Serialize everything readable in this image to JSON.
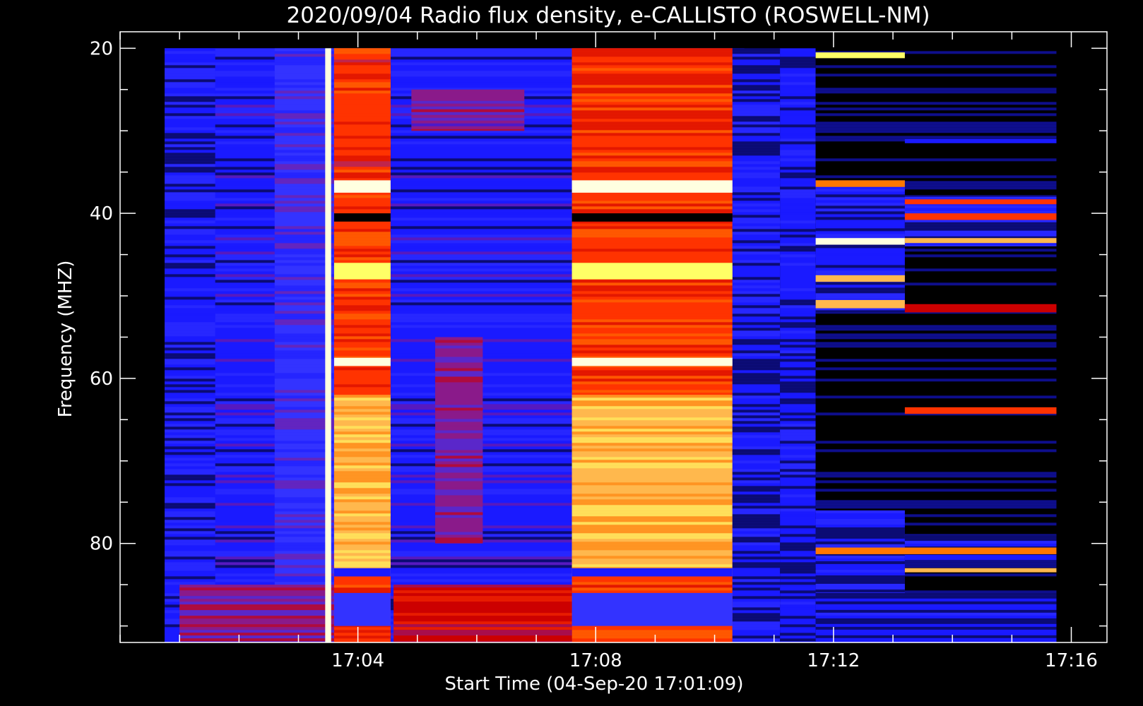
{
  "chart_data": {
    "type": "heatmap",
    "title": "2020/09/04  Radio flux density, e-CALLISTO (ROSWELL-NM)",
    "xlabel": "Start Time (04-Sep-20 17:01:09)",
    "ylabel": "Frequency (MHZ)",
    "x_unit": "minutes after 17:00",
    "xlim": [
      0.0,
      16.6
    ],
    "ylim": [
      92,
      18
    ],
    "y_inverted": true,
    "data_extent": {
      "x": [
        0.75,
        15.75
      ],
      "y": [
        20,
        92
      ]
    },
    "x_ticks": [
      {
        "value": 4,
        "label": "17:04"
      },
      {
        "value": 8,
        "label": "17:08"
      },
      {
        "value": 12,
        "label": "17:12"
      },
      {
        "value": 16,
        "label": "17:16"
      }
    ],
    "x_minor_step": 1,
    "y_ticks": [
      {
        "value": 20,
        "label": "20"
      },
      {
        "value": 40,
        "label": "40"
      },
      {
        "value": 60,
        "label": "60"
      },
      {
        "value": 80,
        "label": "80"
      }
    ],
    "y_minor_step": 5,
    "colormap": [
      "#000000",
      "#1a1aff",
      "#3333ff",
      "#8a1a8a",
      "#cc0000",
      "#ff3300",
      "#ff7700",
      "#ffb84d",
      "#ffff66",
      "#ffffe0"
    ],
    "grid": false,
    "legend": "none",
    "regions": [
      {
        "x": [
          0.75,
          10.5
        ],
        "y": [
          20,
          92
        ],
        "level": 1.4
      },
      {
        "x": [
          0.75,
          1.6
        ],
        "y": [
          20,
          92
        ],
        "level": 1.1
      },
      {
        "x": [
          2.6,
          3.6
        ],
        "y": [
          20,
          92
        ],
        "level": 1.8
      },
      {
        "x": [
          3.6,
          4.55
        ],
        "y": [
          20,
          92
        ],
        "level": 5.0
      },
      {
        "x": [
          3.6,
          4.55
        ],
        "y": [
          20,
          36
        ],
        "level": 4.6
      },
      {
        "x": [
          3.6,
          4.55
        ],
        "y": [
          62,
          84
        ],
        "level": 7.0
      },
      {
        "x": [
          4.9,
          6.8
        ],
        "y": [
          25,
          30
        ],
        "level": 2.6
      },
      {
        "x": [
          5.3,
          6.1
        ],
        "y": [
          55,
          80
        ],
        "level": 2.8
      },
      {
        "x": [
          7.6,
          10.3
        ],
        "y": [
          20,
          92
        ],
        "level": 5.2
      },
      {
        "x": [
          7.6,
          10.3
        ],
        "y": [
          20,
          36
        ],
        "level": 5.0
      },
      {
        "x": [
          7.6,
          10.3
        ],
        "y": [
          62,
          84
        ],
        "level": 7.1
      },
      {
        "x": [
          1.0,
          3.6
        ],
        "y": [
          85,
          92
        ],
        "level": 3.0
      },
      {
        "x": [
          4.6,
          7.6
        ],
        "y": [
          85,
          92
        ],
        "level": 3.8
      },
      {
        "x": [
          10.3,
          11.1
        ],
        "y": [
          20,
          92
        ],
        "level": 1.0
      },
      {
        "x": [
          11.1,
          11.7
        ],
        "y": [
          20,
          92
        ],
        "level": 0.5
      },
      {
        "x": [
          11.7,
          15.75
        ],
        "y": [
          20,
          92
        ],
        "level": 0.0
      },
      {
        "x": [
          11.7,
          13.2
        ],
        "y": [
          36,
          52
        ],
        "level": 1.1
      },
      {
        "x": [
          13.2,
          15.75
        ],
        "y": [
          38,
          44
        ],
        "level": 1.0
      },
      {
        "x": [
          11.7,
          13.2
        ],
        "y": [
          76,
          86
        ],
        "level": 0.9
      },
      {
        "x": [
          13.2,
          15.75
        ],
        "y": [
          79,
          82
        ],
        "level": 0.8
      },
      {
        "x": [
          11.7,
          15.75
        ],
        "y": [
          86,
          92
        ],
        "level": 0.6
      }
    ],
    "bands": [
      {
        "x": [
          3.6,
          4.55
        ],
        "y": [
          36,
          37.5
        ],
        "level": 9.0
      },
      {
        "x": [
          7.6,
          10.3
        ],
        "y": [
          36,
          37.5
        ],
        "level": 9.0
      },
      {
        "x": [
          3.6,
          4.55
        ],
        "y": [
          40,
          41
        ],
        "level": 0.2
      },
      {
        "x": [
          7.6,
          10.3
        ],
        "y": [
          40,
          41
        ],
        "level": 0.2
      },
      {
        "x": [
          3.6,
          4.55
        ],
        "y": [
          46,
          48
        ],
        "level": 7.8
      },
      {
        "x": [
          7.6,
          10.3
        ],
        "y": [
          46,
          48
        ],
        "level": 7.8
      },
      {
        "x": [
          3.6,
          4.55
        ],
        "y": [
          57.5,
          58.5
        ],
        "level": 8.6
      },
      {
        "x": [
          7.6,
          10.3
        ],
        "y": [
          57.5,
          58.5
        ],
        "level": 8.6
      },
      {
        "x": [
          3.6,
          4.55
        ],
        "y": [
          83,
          84
        ],
        "level": 0.5
      },
      {
        "x": [
          7.6,
          10.3
        ],
        "y": [
          83,
          84
        ],
        "level": 0.5
      },
      {
        "x": [
          3.6,
          4.55
        ],
        "y": [
          86,
          90
        ],
        "level": 1.5
      },
      {
        "x": [
          7.6,
          10.3
        ],
        "y": [
          86,
          90
        ],
        "level": 1.5
      },
      {
        "x": [
          11.7,
          13.2
        ],
        "y": [
          20.5,
          21.2
        ],
        "level": 7.5
      },
      {
        "x": [
          11.7,
          13.2
        ],
        "y": [
          36,
          36.8
        ],
        "level": 6.0
      },
      {
        "x": [
          11.7,
          13.2
        ],
        "y": [
          43,
          43.8
        ],
        "level": 9.0
      },
      {
        "x": [
          11.7,
          13.2
        ],
        "y": [
          47.5,
          48.3
        ],
        "level": 6.5
      },
      {
        "x": [
          11.7,
          13.2
        ],
        "y": [
          50.5,
          51.5
        ],
        "level": 7.0
      },
      {
        "x": [
          13.2,
          15.75
        ],
        "y": [
          40,
          40.8
        ],
        "level": 5.2
      },
      {
        "x": [
          13.2,
          15.75
        ],
        "y": [
          43,
          43.6
        ],
        "level": 6.5
      },
      {
        "x": [
          13.2,
          15.75
        ],
        "y": [
          38.3,
          38.9
        ],
        "level": 4.5
      },
      {
        "x": [
          13.2,
          15.75
        ],
        "y": [
          51,
          52
        ],
        "level": 3.8
      },
      {
        "x": [
          13.2,
          15.75
        ],
        "y": [
          63.5,
          64.3
        ],
        "level": 5.0
      },
      {
        "x": [
          11.7,
          15.75
        ],
        "y": [
          80.5,
          81.3
        ],
        "level": 5.5
      },
      {
        "x": [
          13.2,
          15.75
        ],
        "y": [
          83,
          83.5
        ],
        "level": 6.5
      },
      {
        "x": [
          13.2,
          15.75
        ],
        "y": [
          31,
          31.5
        ],
        "level": 1.0
      },
      {
        "x": [
          3.45,
          3.55
        ],
        "y": [
          20,
          92
        ],
        "level": 8.5
      }
    ]
  }
}
